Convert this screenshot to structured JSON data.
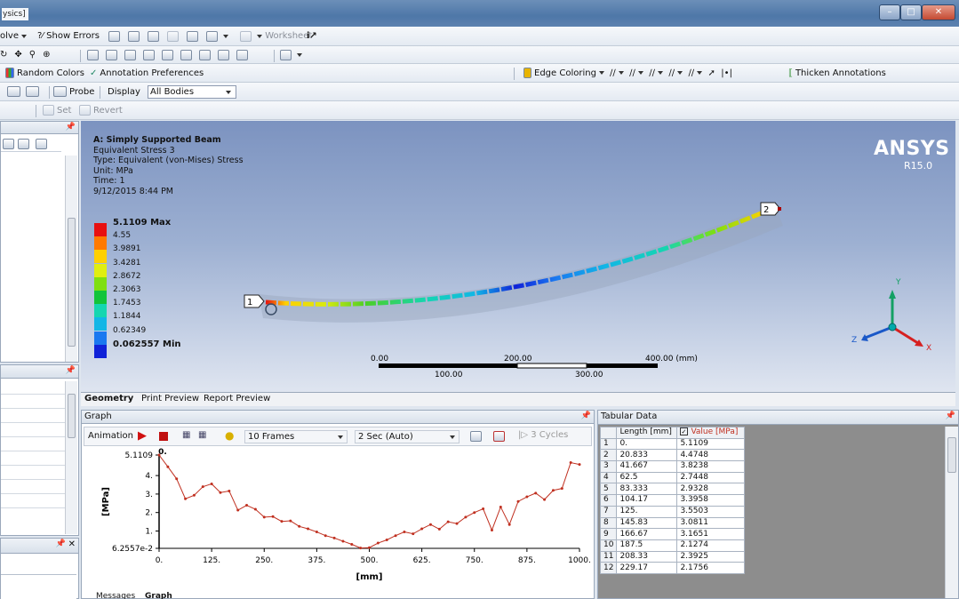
{
  "window": {
    "title": "ysics]"
  },
  "toolbar1": {
    "solve": "olve",
    "show_errors": "?⁄ Show Errors",
    "worksheet": "Worksheet"
  },
  "toolbar3": {
    "random_colors": "Random Colors",
    "annotation_prefs": "Annotation Preferences",
    "edge_coloring": "Edge Coloring",
    "thicken": "Thicken Annotations"
  },
  "toolbar4": {
    "probe": "Probe",
    "display": "Display",
    "all_bodies": "All Bodies"
  },
  "toolbar5": {
    "set": "Set",
    "revert": "Revert"
  },
  "viewport": {
    "info": [
      "A: Simply Supported Beam",
      "Equivalent Stress 3",
      "Type: Equivalent (von-Mises) Stress",
      "Unit: MPa",
      "Time: 1",
      "9/12/2015 8:44 PM"
    ],
    "brand": "ANSYS",
    "version": "R15.0",
    "legend": [
      {
        "label": "5.1109 Max",
        "color": "#e81010",
        "bold": true
      },
      {
        "label": "4.55",
        "color": "#ff7a00"
      },
      {
        "label": "3.9891",
        "color": "#ffd000"
      },
      {
        "label": "3.4281",
        "color": "#e0ee10"
      },
      {
        "label": "2.8672",
        "color": "#7fdf10"
      },
      {
        "label": "2.3063",
        "color": "#12c43a"
      },
      {
        "label": "1.7453",
        "color": "#15d6b0"
      },
      {
        "label": "1.1844",
        "color": "#12b6e6"
      },
      {
        "label": "0.62349",
        "color": "#1a78f0"
      },
      {
        "label": "0.062557 Min",
        "color": "#1022d8",
        "bold": true
      }
    ],
    "scale": {
      "top": [
        "0.00",
        "200.00",
        "400.00 (mm)"
      ],
      "bottom": [
        "100.00",
        "300.00"
      ]
    },
    "node1": "1",
    "node2": "2",
    "axis_y": "Y",
    "axis_z": "Z",
    "axis_x": "X"
  },
  "view_tabs": [
    "Geometry",
    "Print Preview",
    "Report Preview"
  ],
  "graph": {
    "title": "Graph",
    "animation": "Animation",
    "frames": "10 Frames",
    "duration": "2 Sec (Auto)",
    "cycles": "3 Cycles",
    "ylabel": "[MPa]",
    "xlabel": "[mm]",
    "bottom_tabs": [
      "Messages",
      "Graph"
    ]
  },
  "tabular": {
    "title": "Tabular Data",
    "headers": [
      "",
      "Length [mm]",
      "Value [MPa]"
    ],
    "rows": [
      [
        "1",
        "0.",
        "5.1109"
      ],
      [
        "2",
        "20.833",
        "4.4748"
      ],
      [
        "3",
        "41.667",
        "3.8238"
      ],
      [
        "4",
        "62.5",
        "2.7448"
      ],
      [
        "5",
        "83.333",
        "2.9328"
      ],
      [
        "6",
        "104.17",
        "3.3958"
      ],
      [
        "7",
        "125.",
        "3.5503"
      ],
      [
        "8",
        "145.83",
        "3.0811"
      ],
      [
        "9",
        "166.67",
        "3.1651"
      ],
      [
        "10",
        "187.5",
        "2.1274"
      ],
      [
        "11",
        "208.33",
        "2.3925"
      ],
      [
        "12",
        "229.17",
        "2.1756"
      ]
    ]
  },
  "chart_data": {
    "type": "line",
    "title": "",
    "xlabel": "[mm]",
    "ylabel": "[MPa]",
    "xlim": [
      0,
      1000
    ],
    "ylim": [
      0.062557,
      5.1109
    ],
    "xticks": [
      "0.",
      "125.",
      "250.",
      "375.",
      "500.",
      "625.",
      "750.",
      "875.",
      "1000."
    ],
    "yticks": [
      "5.1109",
      "4.",
      "3.",
      "2.",
      "1.",
      "6.2557e-2"
    ],
    "top_label": "0.",
    "color": "#c03020",
    "series": [
      {
        "x": [
          0,
          20.833,
          41.667,
          62.5,
          83.333,
          104.17,
          125,
          145.83,
          166.67,
          187.5,
          208.33,
          229.17,
          250,
          270.83,
          291.67,
          312.5,
          333.33,
          354.17,
          375,
          395.83,
          416.67,
          437.5,
          458.33,
          479.17,
          500,
          520.83,
          541.67,
          562.5,
          583.33,
          604.17,
          625,
          645.83,
          666.67,
          687.5,
          708.33,
          729.17,
          750,
          770.83,
          791.67,
          812.5,
          833.33,
          854.17,
          875,
          895.83,
          916.67,
          937.5,
          958.33,
          979.17,
          1000
        ],
        "y": [
          5.1109,
          4.4748,
          3.8238,
          2.7448,
          2.9328,
          3.3958,
          3.5503,
          3.0811,
          3.1651,
          2.1274,
          2.3925,
          2.1756,
          1.75,
          1.78,
          1.52,
          1.55,
          1.25,
          1.12,
          0.95,
          0.75,
          0.62,
          0.45,
          0.28,
          0.08,
          0.1,
          0.35,
          0.52,
          0.75,
          0.95,
          0.85,
          1.12,
          1.35,
          1.1,
          1.5,
          1.4,
          1.75,
          2.0,
          2.2,
          1.05,
          2.3,
          1.35,
          2.6,
          2.85,
          3.05,
          2.7,
          3.2,
          3.3,
          4.7,
          4.6
        ]
      }
    ]
  }
}
